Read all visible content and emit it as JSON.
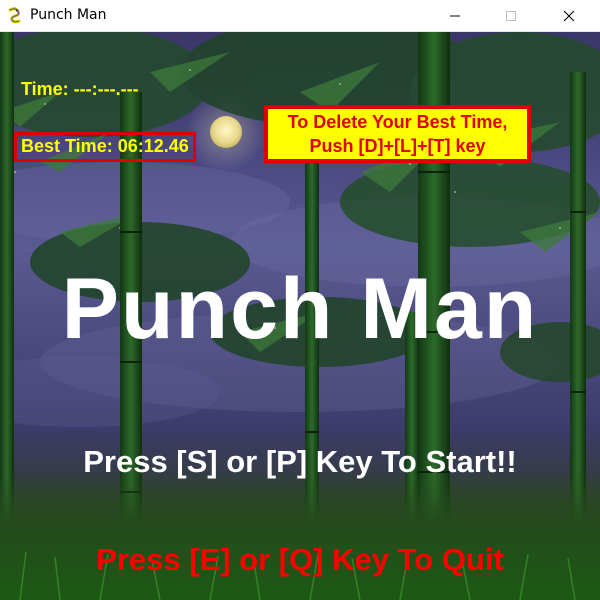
{
  "window": {
    "title": "Punch Man",
    "icon": "pygame-snake-icon",
    "controls": [
      "minimize-icon",
      "maximize-icon",
      "close-icon"
    ]
  },
  "hud": {
    "time_label": "Time: ---:---.---",
    "best_time_label": "Best Time: 06:12.46"
  },
  "notice": {
    "line1": "To Delete Your Best Time,",
    "line2": "Push [D]+[L]+[T] key"
  },
  "title_screen": {
    "game_title": "Punch Man",
    "start_prompt": "Press [S] or [P] Key To Start!!",
    "quit_prompt": "Press [E] or [Q] Key To Quit"
  },
  "colors": {
    "hud_text": "#ffff00",
    "notice_bg": "#ffff00",
    "alert_red": "#e00000",
    "title_text": "#ffffff",
    "quit_text": "#ff0000"
  }
}
